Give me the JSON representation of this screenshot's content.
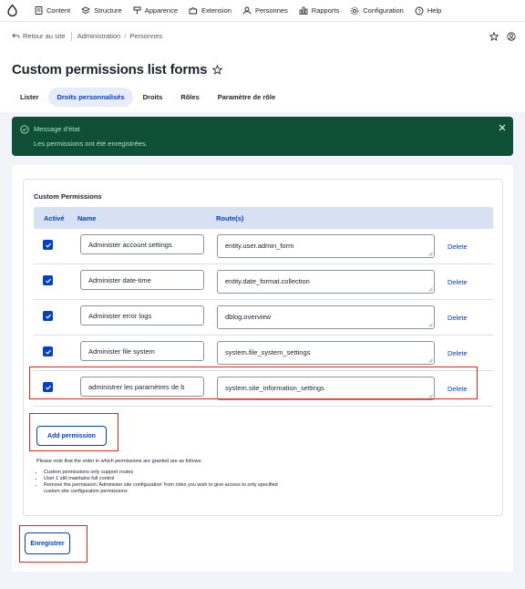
{
  "toolbar": {
    "items": [
      {
        "label": "Content",
        "icon": "document-icon"
      },
      {
        "label": "Structure",
        "icon": "structure-icon"
      },
      {
        "label": "Apparence",
        "icon": "paint-icon"
      },
      {
        "label": "Extension",
        "icon": "puzzle-icon"
      },
      {
        "label": "Personnes",
        "icon": "person-icon"
      },
      {
        "label": "Rapports",
        "icon": "chart-icon"
      },
      {
        "label": "Configuration",
        "icon": "gear-icon"
      },
      {
        "label": "Help",
        "icon": "help-icon"
      }
    ]
  },
  "breadcrumb": {
    "back": "Retour au site",
    "items": [
      "Administration",
      "Personnes"
    ]
  },
  "page": {
    "title": "Custom permissions list forms",
    "tabs": [
      {
        "label": "Lister",
        "active": false
      },
      {
        "label": "Droits personnalisés",
        "active": true
      },
      {
        "label": "Droits",
        "active": false
      },
      {
        "label": "Rôles",
        "active": false
      },
      {
        "label": "Paramètre de rôle",
        "active": false
      }
    ]
  },
  "status": {
    "heading": "Message d'état",
    "message": "Les permissions ont été enregistrées."
  },
  "permissions": {
    "title": "Custom Permissions",
    "columns": {
      "active": "Activé",
      "name": "Name",
      "routes": "Route(s)"
    },
    "rows": [
      {
        "checked": true,
        "name": "Administer account settings",
        "route": "entity.user.admin_form",
        "delete": "Delete"
      },
      {
        "checked": true,
        "name": "Administer date-time",
        "route": "entity.date_format.collection",
        "delete": "Delete"
      },
      {
        "checked": true,
        "name": "Administer error logs",
        "route": "dblog.overview",
        "delete": "Delete"
      },
      {
        "checked": true,
        "name": "Administer file system",
        "route": "system.file_system_settings",
        "delete": "Delete"
      },
      {
        "checked": true,
        "name": "administrer les paramètres de b",
        "route": "system.site_information_settings",
        "delete": "Delete"
      }
    ],
    "add_button": "Add permission",
    "note_intro": "Please note that the order in which permissions are granted are as follows:",
    "notes": [
      "Custom permissions only support routes",
      "User 1 still maintains full control",
      "Remove the permission 'Administer site configuration' from roles you wish to give access to only specified custom site configuration permissions"
    ]
  },
  "save_button": "Enregistrer",
  "colors": {
    "accent": "#003ecc",
    "status_bg": "#0f4f37",
    "highlight": "#e0251b"
  }
}
